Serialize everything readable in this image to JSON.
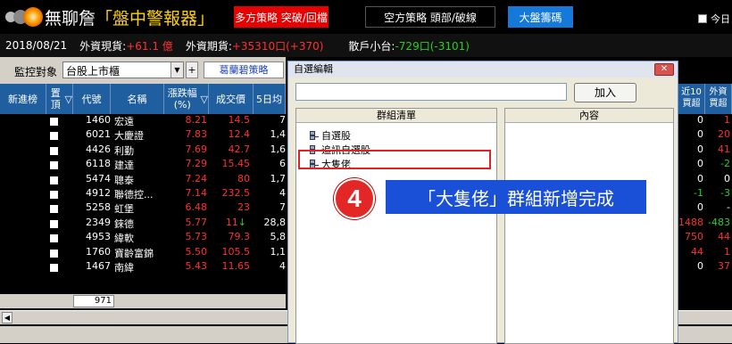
{
  "app": {
    "title_prefix": "無聊詹",
    "title_main": "「盤中警報器」",
    "tabs": [
      "多方策略 突破/回檔",
      "空方策略 頭部/破線",
      "大盤籌碼"
    ],
    "today_label": "今日"
  },
  "infobar": {
    "date": "2018/08/21",
    "foreign_spot_label": "外資現貨:",
    "foreign_spot_value": "+61.1 億",
    "foreign_futures_label": "外資期貨:",
    "foreign_futures_value": "+35310口(+370)",
    "retail_label": "散戶小台:",
    "retail_value": "-729口(-3101)"
  },
  "filter": {
    "label": "監控對象",
    "selected": "台股上市櫃",
    "strategy": "葛蘭碧策略"
  },
  "table": {
    "headers": [
      "新進榜",
      "置頂",
      "代號",
      "名稱",
      "漲跌幅(%)",
      "成交價",
      "5日均"
    ],
    "rows": [
      {
        "code": "1460",
        "name": "宏遠",
        "pct": "8.21",
        "price": "14.5",
        "vol": "7"
      },
      {
        "code": "6021",
        "name": "大慶證",
        "pct": "7.83",
        "price": "12.4",
        "vol": "1,4"
      },
      {
        "code": "4426",
        "name": "利勤",
        "pct": "7.69",
        "price": "42.7",
        "vol": "1,6"
      },
      {
        "code": "6118",
        "name": "建達",
        "pct": "7.29",
        "price": "15.45",
        "vol": "6"
      },
      {
        "code": "5474",
        "name": "聰泰",
        "pct": "7.24",
        "price": "80",
        "vol": "1,7"
      },
      {
        "code": "4912",
        "name": "聯德控...",
        "pct": "7.14",
        "price": "232.5",
        "vol": "4"
      },
      {
        "code": "5258",
        "name": "虹堡",
        "pct": "6.48",
        "price": "23",
        "vol": "7"
      },
      {
        "code": "2349",
        "name": "錸德",
        "pct": "5.77",
        "price": "11",
        "vol": "28,8",
        "arrow": "↓"
      },
      {
        "code": "4953",
        "name": "緯軟",
        "pct": "5.73",
        "price": "79.3",
        "vol": "5,8"
      },
      {
        "code": "1760",
        "name": "寶齡富錦",
        "pct": "5.50",
        "price": "105.5",
        "vol": "1,1"
      },
      {
        "code": "1467",
        "name": "南緯",
        "pct": "5.43",
        "price": "11.65",
        "vol": "4"
      }
    ],
    "footer_count": "971",
    "right_headers": [
      "近10買超",
      "外資買超"
    ],
    "right_values": [
      [
        "0",
        "1"
      ],
      [
        "0",
        "20"
      ],
      [
        "0",
        "41"
      ],
      [
        "0",
        "-2"
      ],
      [
        "0",
        "0"
      ],
      [
        "-1",
        "-3"
      ],
      [
        "0",
        "-"
      ],
      [
        "1488",
        "-483"
      ],
      [
        "750",
        "44"
      ],
      [
        "44",
        "1"
      ],
      [
        "0",
        "37"
      ]
    ]
  },
  "dialog": {
    "title": "自選編輯",
    "add_button": "加入",
    "group_header": "群組清單",
    "content_header": "內容",
    "groups": [
      "自選股",
      "追訊自選股",
      "大隻佬"
    ]
  },
  "callout": {
    "step": "4",
    "text": "「大隻佬」群組新增完成"
  }
}
